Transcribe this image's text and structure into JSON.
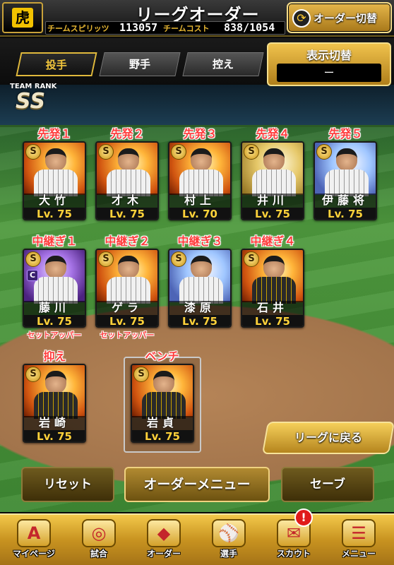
{
  "header": {
    "logo": "虎",
    "title": "リーグオーダー",
    "spirit_label": "チームスピリッツ",
    "spirit_value": "113057",
    "cost_label": "チームコスト",
    "cost_value": "838/1054",
    "swap_button": "オーダー切替",
    "swap_icon": "swap-arrows-icon"
  },
  "tabs": [
    {
      "label": "投手",
      "active": true
    },
    {
      "label": "野手",
      "active": false
    },
    {
      "label": "控え",
      "active": false
    }
  ],
  "display_toggle": {
    "label": "表示切替",
    "value": "ー"
  },
  "team_rank": {
    "label": "TEAM RANK",
    "value": "SS"
  },
  "starters": [
    {
      "role": "先発１",
      "name": "大竹",
      "level": "Lv. 75",
      "rarity": "S"
    },
    {
      "role": "先発２",
      "name": "才木",
      "level": "Lv. 75",
      "rarity": "S"
    },
    {
      "role": "先発３",
      "name": "村上",
      "level": "Lv. 70",
      "rarity": "S"
    },
    {
      "role": "先発４",
      "name": "井川",
      "level": "Lv. 75",
      "rarity": "S"
    },
    {
      "role": "先発５",
      "name": "伊藤将",
      "level": "Lv. 75",
      "rarity": "S"
    }
  ],
  "relievers": [
    {
      "role": "中継ぎ１",
      "name": "藤川",
      "level": "Lv. 75",
      "rarity": "S",
      "badge": "C",
      "sub": "セットアッパー"
    },
    {
      "role": "中継ぎ２",
      "name": "ゲラ",
      "level": "Lv. 75",
      "rarity": "S",
      "sub": "セットアッパー"
    },
    {
      "role": "中継ぎ３",
      "name": "漆原",
      "level": "Lv. 75",
      "rarity": "S"
    },
    {
      "role": "中継ぎ４",
      "name": "石井",
      "level": "Lv. 75",
      "rarity": "S"
    }
  ],
  "closer": {
    "role": "抑え",
    "name": "岩崎",
    "level": "Lv. 75",
    "rarity": "S"
  },
  "bench": {
    "role": "ベンチ",
    "name": "岩貞",
    "level": "Lv. 75",
    "rarity": "S"
  },
  "buttons": {
    "return": "リーグに戻る",
    "reset": "リセット",
    "order_menu": "オーダーメニュー",
    "save": "セーブ"
  },
  "nav": [
    {
      "label": "マイページ",
      "icon": "A",
      "icon_name": "mypage-icon"
    },
    {
      "label": "試合",
      "icon": "◎",
      "icon_name": "stadium-icon"
    },
    {
      "label": "オーダー",
      "icon": "◆",
      "icon_name": "order-field-icon"
    },
    {
      "label": "選手",
      "icon": "⚾",
      "icon_name": "player-icon"
    },
    {
      "label": "スカウト",
      "icon": "✉",
      "icon_name": "scout-icon"
    },
    {
      "label": "メニュー",
      "icon": "☰",
      "icon_name": "menu-icon"
    }
  ],
  "notification": "!"
}
